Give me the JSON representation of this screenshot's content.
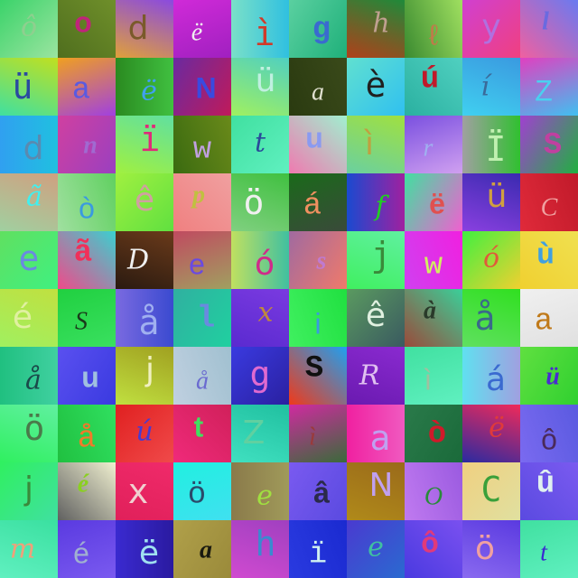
{
  "grid": {
    "rows": [
      [
        {
          "char": "ô",
          "bg1": "#3bd36a",
          "bg2": "#9be4a0",
          "fg": "#8fcf8f"
        },
        {
          "char": "o",
          "bg1": "#4f6e1e",
          "bg2": "#6f8f2a",
          "fg": "#c0247a"
        },
        {
          "char": "d",
          "bg1": "#8a4ae0",
          "bg2": "#e0a03a",
          "fg": "#7a5a2a"
        },
        {
          "char": "ë",
          "bg1": "#d02ad8",
          "bg2": "#a020c0",
          "fg": "#f0f0f0"
        },
        {
          "char": "ì",
          "bg1": "#7ae0c8",
          "bg2": "#30c0e0",
          "fg": "#d03a2a"
        },
        {
          "char": "g",
          "bg1": "#1fb07a",
          "bg2": "#5ad0a0",
          "fg": "#3a6ad0"
        },
        {
          "char": "h",
          "bg1": "#b0401a",
          "bg2": "#1f8a3a",
          "fg": "#c0a090"
        },
        {
          "char": "ℓ",
          "bg1": "#a0e060",
          "bg2": "#3a8a30",
          "fg": "#c07a4a"
        },
        {
          "char": "y",
          "bg1": "#d040d0",
          "bg2": "#f04080",
          "fg": "#b070e0"
        },
        {
          "char": "l",
          "bg1": "#f060a0",
          "bg2": "#6a7af0",
          "fg": "#6a6ae0"
        }
      ],
      [
        {
          "char": "ü",
          "bg1": "#c0e020",
          "bg2": "#40e0a0",
          "fg": "#2a4aa0"
        },
        {
          "char": "a",
          "bg1": "#f0a020",
          "bg2": "#a040e0",
          "fg": "#5a5ae0"
        },
        {
          "char": "ë",
          "bg1": "#2a8a20",
          "bg2": "#40c040",
          "fg": "#40a0f0"
        },
        {
          "char": "N",
          "bg1": "#c01a5a",
          "bg2": "#6a2aa0",
          "fg": "#3a4ae0"
        },
        {
          "char": "ü",
          "bg1": "#a0f060",
          "bg2": "#50d0c0",
          "fg": "#c0f0e0"
        },
        {
          "char": "a",
          "bg1": "#3a4a1a",
          "bg2": "#2a3a10",
          "fg": "#e0e0d0"
        },
        {
          "char": "è",
          "bg1": "#60e0d0",
          "bg2": "#30c0f0",
          "fg": "#202020"
        },
        {
          "char": "ú",
          "bg1": "#2ab0a0",
          "bg2": "#50d0c0",
          "fg": "#c01a2a"
        },
        {
          "char": "í",
          "bg1": "#3a9ae0",
          "bg2": "#40d0f0",
          "fg": "#3a6a9a"
        },
        {
          "char": "Z",
          "bg1": "#e040c0",
          "bg2": "#40c0f0",
          "fg": "#4ad0f0"
        }
      ],
      [
        {
          "char": "d",
          "bg1": "#30a0f0",
          "bg2": "#20c0e0",
          "fg": "#5a8ab0"
        },
        {
          "char": "n",
          "bg1": "#9a40c0",
          "bg2": "#d040a0",
          "fg": "#a06ad0"
        },
        {
          "char": "ï",
          "bg1": "#a0f040",
          "bg2": "#60e0a0",
          "fg": "#e02a7a"
        },
        {
          "char": "w",
          "bg1": "#6a8a1a",
          "bg2": "#3a6a10",
          "fg": "#c0a0e0"
        },
        {
          "char": "t",
          "bg1": "#40e0a0",
          "bg2": "#60f0c0",
          "fg": "#2a4a9a"
        },
        {
          "char": "u",
          "bg1": "#f07ab0",
          "bg2": "#a0f0d0",
          "fg": "#8a9af0"
        },
        {
          "char": "ì",
          "bg1": "#a0e040",
          "bg2": "#6ad0a0",
          "fg": "#c0a040"
        },
        {
          "char": "r",
          "bg1": "#7a50e0",
          "bg2": "#d0a0f0",
          "fg": "#a0b0f0"
        },
        {
          "char": "Ï",
          "bg1": "#a0a0a0",
          "bg2": "#30c030",
          "fg": "#c0f0b0"
        },
        {
          "char": "S",
          "bg1": "#20b040",
          "bg2": "#a040d0",
          "fg": "#c040a0"
        }
      ],
      [
        {
          "char": "ã",
          "bg1": "#a0d0a0",
          "bg2": "#d0a080",
          "fg": "#40f0f0"
        },
        {
          "char": "ò",
          "bg1": "#60d060",
          "bg2": "#a0e0a0",
          "fg": "#3a9ae0"
        },
        {
          "char": "ê",
          "bg1": "#a0f040",
          "bg2": "#60e040",
          "fg": "#d0a0a0"
        },
        {
          "char": "p",
          "bg1": "#f08080",
          "bg2": "#f0a0a0",
          "fg": "#c0c040"
        },
        {
          "char": "ö",
          "bg1": "#40c040",
          "bg2": "#80d080",
          "fg": "#f0f0f0"
        },
        {
          "char": "á",
          "bg1": "#1a6a1a",
          "bg2": "#3a4a3a",
          "fg": "#f09060"
        },
        {
          "char": "f",
          "bg1": "#1a4ad0",
          "bg2": "#a020a0",
          "fg": "#20d020"
        },
        {
          "char": "ë",
          "bg1": "#f060d0",
          "bg2": "#40e0a0",
          "fg": "#e05050"
        },
        {
          "char": "ü",
          "bg1": "#8a40e0",
          "bg2": "#3a2ab0",
          "fg": "#d0a040"
        },
        {
          "char": "C",
          "bg1": "#c01a2a",
          "bg2": "#e02a3a",
          "fg": "#f0a0a0"
        }
      ],
      [
        {
          "char": "e",
          "bg1": "#60e060",
          "bg2": "#40f080",
          "fg": "#6a8ae0"
        },
        {
          "char": "ã",
          "bg1": "#f04a8a",
          "bg2": "#3ad0d0",
          "fg": "#f0305a"
        },
        {
          "char": "D",
          "bg1": "#6a3a1a",
          "bg2": "#2a1a10",
          "fg": "#f0f0f0"
        },
        {
          "char": "e",
          "bg1": "#c04a60",
          "bg2": "#a0a060",
          "fg": "#6a4ae0"
        },
        {
          "char": "ó",
          "bg1": "#c0e060",
          "bg2": "#40c0a0",
          "fg": "#d02a8a"
        },
        {
          "char": "s",
          "bg1": "#f07a6a",
          "bg2": "#a06aa0",
          "fg": "#c07ad0"
        },
        {
          "char": "j",
          "bg1": "#40f060",
          "bg2": "#60f0a0",
          "fg": "#3a8a3a"
        },
        {
          "char": "w",
          "bg1": "#f020e0",
          "bg2": "#d040f0",
          "fg": "#d0f060"
        },
        {
          "char": "ó",
          "bg1": "#40f040",
          "bg2": "#f0d030",
          "fg": "#e05a3a"
        },
        {
          "char": "ù",
          "bg1": "#f0d030",
          "bg2": "#f0e050",
          "fg": "#40a0e0"
        }
      ],
      [
        {
          "char": "é",
          "bg1": "#c0e040",
          "bg2": "#a0f060",
          "fg": "#e0f0a0"
        },
        {
          "char": "S",
          "bg1": "#20d040",
          "bg2": "#3ae060",
          "fg": "#1a3a1a"
        },
        {
          "char": "å",
          "bg1": "#7a6ae0",
          "bg2": "#3a4ad0",
          "fg": "#a0b0f0"
        },
        {
          "char": "l",
          "bg1": "#20d0a0",
          "bg2": "#30b0a0",
          "fg": "#6a8ae0"
        },
        {
          "char": "x",
          "bg1": "#5a2ad0",
          "bg2": "#7a3ae0",
          "fg": "#c08a3a"
        },
        {
          "char": "i",
          "bg1": "#20e040",
          "bg2": "#40f060",
          "fg": "#3a9ae0"
        },
        {
          "char": "ê",
          "bg1": "#5a9a60",
          "bg2": "#3a5a60",
          "fg": "#e0f0e0"
        },
        {
          "char": "à",
          "bg1": "#9a4a3a",
          "bg2": "#3ad09a",
          "fg": "#2a3a2a"
        },
        {
          "char": "å",
          "bg1": "#30e020",
          "bg2": "#60e060",
          "fg": "#3a6a8a"
        },
        {
          "char": "a",
          "bg1": "#f0f0f0",
          "bg2": "#e0e0e0",
          "fg": "#c07a1a"
        }
      ],
      [
        {
          "char": "å",
          "bg1": "#20c080",
          "bg2": "#40d0a0",
          "fg": "#1a4a4a"
        },
        {
          "char": "u",
          "bg1": "#3a3ae0",
          "bg2": "#5a50f0",
          "fg": "#a0c0e0"
        },
        {
          "char": "j",
          "bg1": "#c0e040",
          "bg2": "#a0a020",
          "fg": "#f0f0c0"
        },
        {
          "char": "å",
          "bg1": "#a0c0d0",
          "bg2": "#c0d0e0",
          "fg": "#6a6ad0"
        },
        {
          "char": "g",
          "bg1": "#3a3ae0",
          "bg2": "#2a20a0",
          "fg": "#e06ad0"
        },
        {
          "char": "S",
          "bg1": "#f03a1a",
          "bg2": "#20a0f0",
          "fg": "#101010"
        },
        {
          "char": "R",
          "bg1": "#8a2ad0",
          "bg2": "#6a1ab0",
          "fg": "#e0c0f0"
        },
        {
          "char": "ì",
          "bg1": "#40e0a0",
          "bg2": "#60f0c0",
          "fg": "#a0c0a0"
        },
        {
          "char": "á",
          "bg1": "#60e0f0",
          "bg2": "#a0a0e0",
          "fg": "#3a6ad0"
        },
        {
          "char": "ü",
          "bg1": "#30d030",
          "bg2": "#60e040",
          "fg": "#4a2ad0"
        }
      ],
      [
        {
          "char": "ö",
          "bg1": "#30f060",
          "bg2": "#60f0a0",
          "fg": "#4a7a4a"
        },
        {
          "char": "å",
          "bg1": "#30e060",
          "bg2": "#20c040",
          "fg": "#f07a2a"
        },
        {
          "char": "ú",
          "bg1": "#e02020",
          "bg2": "#f04a4a",
          "fg": "#4a3ad0"
        },
        {
          "char": "t",
          "bg1": "#f02a7a",
          "bg2": "#d0205a",
          "fg": "#40e060"
        },
        {
          "char": "Z",
          "bg1": "#20c0a0",
          "bg2": "#40e0c0",
          "fg": "#60d0a0"
        },
        {
          "char": "ì",
          "bg1": "#d02aa0",
          "bg2": "#3a6a3a",
          "fg": "#9a3a3a"
        },
        {
          "char": "a",
          "bg1": "#f020a0",
          "bg2": "#f05ac0",
          "fg": "#c0a0f0"
        },
        {
          "char": "ò",
          "bg1": "#1a6a3a",
          "bg2": "#2a7a4a",
          "fg": "#d01a2a"
        },
        {
          "char": "ë",
          "bg1": "#2a2aa0",
          "bg2": "#f02a5a",
          "fg": "#e03a3a"
        },
        {
          "char": "ô",
          "bg1": "#5a5ae0",
          "bg2": "#7a6af0",
          "fg": "#4a2a5a"
        }
      ],
      [
        {
          "char": "j",
          "bg1": "#30f060",
          "bg2": "#40e0a0",
          "fg": "#3a8a3a"
        },
        {
          "char": "é",
          "bg1": "#606060",
          "bg2": "#f0f0d0",
          "fg": "#8ad020"
        },
        {
          "char": "x",
          "bg1": "#f02a6a",
          "bg2": "#e0205a",
          "fg": "#f0d0d0"
        },
        {
          "char": "ö",
          "bg1": "#20f0e0",
          "bg2": "#40e0f0",
          "fg": "#2a4a6a"
        },
        {
          "char": "e",
          "bg1": "#8a7a4a",
          "bg2": "#a09a5a",
          "fg": "#a0e040"
        },
        {
          "char": "â",
          "bg1": "#5a4ae0",
          "bg2": "#7a5af0",
          "fg": "#2a2a4a"
        },
        {
          "char": "N",
          "bg1": "#b08a1a",
          "bg2": "#9a6a1a",
          "fg": "#c0a0f0"
        },
        {
          "char": "O",
          "bg1": "#9a5ae0",
          "bg2": "#c07af0",
          "fg": "#2a8a3a"
        },
        {
          "char": "C",
          "bg1": "#f0d080",
          "bg2": "#e0e0a0",
          "fg": "#3aa03a"
        },
        {
          "char": "û",
          "bg1": "#5a4ae0",
          "bg2": "#7a5af0",
          "fg": "#e0f0f0"
        }
      ],
      [
        {
          "char": "m",
          "bg1": "#3ae0a0",
          "bg2": "#60f0c0",
          "fg": "#f0a07a"
        },
        {
          "char": "é",
          "bg1": "#5a3ae0",
          "bg2": "#7a5af0",
          "fg": "#a0b0d0"
        },
        {
          "char": "ë",
          "bg1": "#3a2ad0",
          "bg2": "#2a1aa0",
          "fg": "#a0e0f0"
        },
        {
          "char": "a",
          "bg1": "#9a8a3a",
          "bg2": "#b0a04a",
          "fg": "#1a1a10"
        },
        {
          "char": "h",
          "bg1": "#d04ad0",
          "bg2": "#a040c0",
          "fg": "#3a8ad0"
        },
        {
          "char": "ï",
          "bg1": "#1a2ad0",
          "bg2": "#2a3ae0",
          "fg": "#d0f0f0"
        },
        {
          "char": "e",
          "bg1": "#4a3ad0",
          "bg2": "#2a6ad0",
          "fg": "#40c0a0"
        },
        {
          "char": "ô",
          "bg1": "#4a3ae0",
          "bg2": "#7a50f0",
          "fg": "#e03a7a"
        },
        {
          "char": "ö",
          "bg1": "#5a3ae0",
          "bg2": "#8a6af0",
          "fg": "#f0a0a0"
        },
        {
          "char": "t",
          "bg1": "#40e0a0",
          "bg2": "#60f0c0",
          "fg": "#3a2ad0"
        }
      ]
    ]
  }
}
